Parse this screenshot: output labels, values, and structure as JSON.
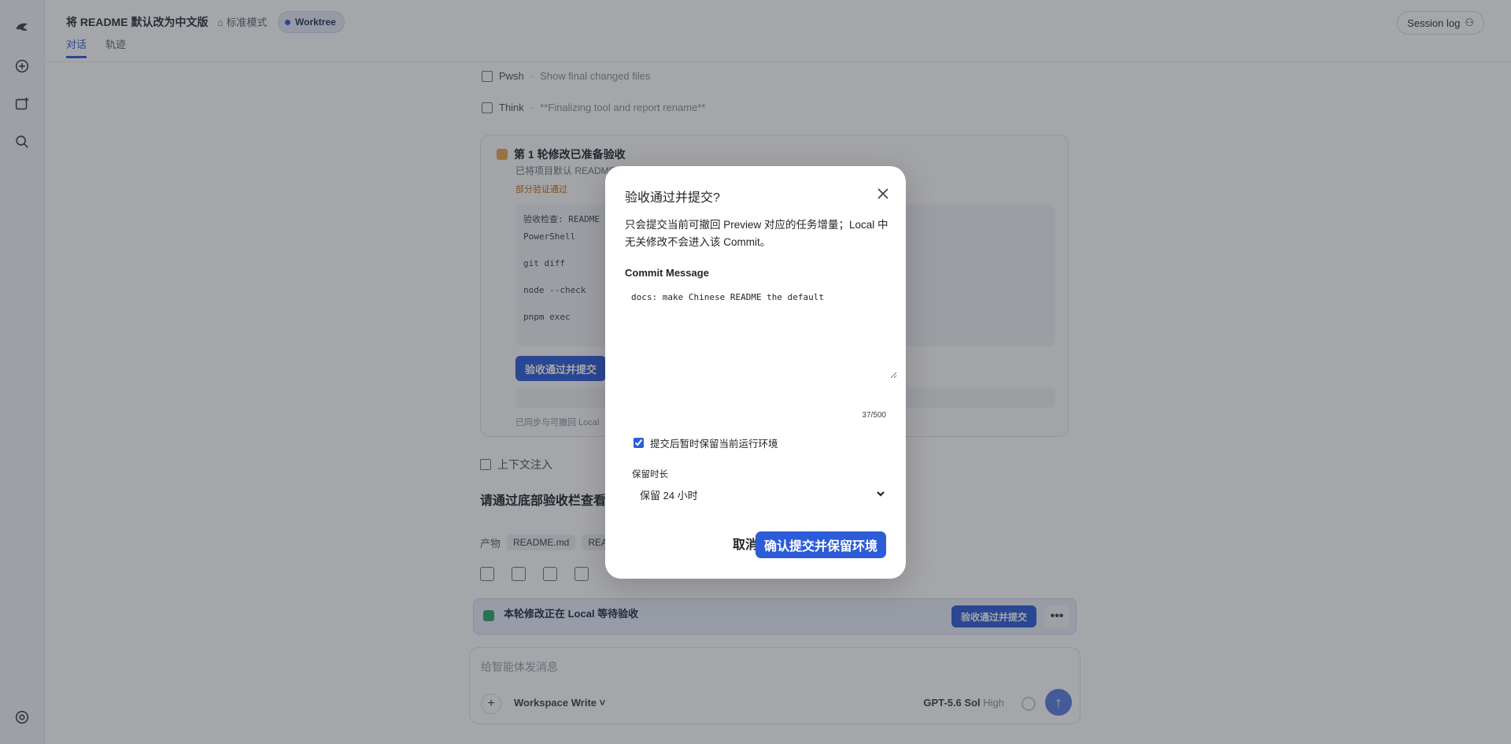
{
  "header": {
    "title": "将 README 默认改为中文版",
    "mode": "标准模式",
    "worktree_badge": "Worktree",
    "session_log": "Session log"
  },
  "tabs": [
    {
      "label": "对话",
      "active": true
    },
    {
      "label": "轨迹",
      "active": false
    }
  ],
  "transcript": {
    "line1": {
      "tag": "Pwsh",
      "text": "Show final changed files"
    },
    "line2": {
      "tag": "Think",
      "text": "**Finalizing tool and report rename**"
    },
    "card": {
      "title": "第 1 轮修改已准备验收",
      "subtitle": "已将项目默认 README",
      "meta": "",
      "badge": "部分验证通过",
      "inner_lines": [
        "验收检查: README",
        "PowerShell",
        "git diff",
        "node --check",
        "pnpm exec"
      ],
      "button": "验收通过并提交",
      "note": "",
      "foot": "已同步与可撤回 Local"
    },
    "context": "上下文注入",
    "bigline": "请通过底部验收栏查看",
    "artifacts_label": "产物",
    "artifacts": [
      "README.md",
      "REA"
    ]
  },
  "accept_bar": {
    "title": "本轮修改正在 Local 等待验收",
    "subtitle": "",
    "button": "验收通过并提交",
    "more": "•••"
  },
  "composer": {
    "placeholder": "给智能体发消息",
    "workspace": "Workspace Write",
    "model": "GPT-5.6 Sol",
    "effort": "High",
    "send_glyph": "↑"
  },
  "status_bar": "",
  "modal": {
    "title": "验收通过并提交?",
    "description": "只会提交当前可撤回 Preview 对应的任务增量；Local 中无关修改不会进入该 Commit。",
    "commit_label": "Commit Message",
    "commit_value": "docs: make Chinese README the default",
    "char_count": "37/500",
    "keep_env_label": "提交后暂时保留当前运行环境",
    "keep_env_checked": true,
    "duration_label": "保留时长",
    "duration_value": "保留 24 小时",
    "cancel_label": "取消",
    "confirm_label": "确认提交并保留环境"
  },
  "colors": {
    "accent": "#2c5cd8",
    "overlay": "rgba(40,44,52,0.42)"
  },
  "icons": [
    "app-logo-icon",
    "new-chat-icon",
    "new-project-icon",
    "search-icon",
    "settings-icon",
    "close-icon",
    "chevron-down-icon",
    "checkbox-icon"
  ]
}
